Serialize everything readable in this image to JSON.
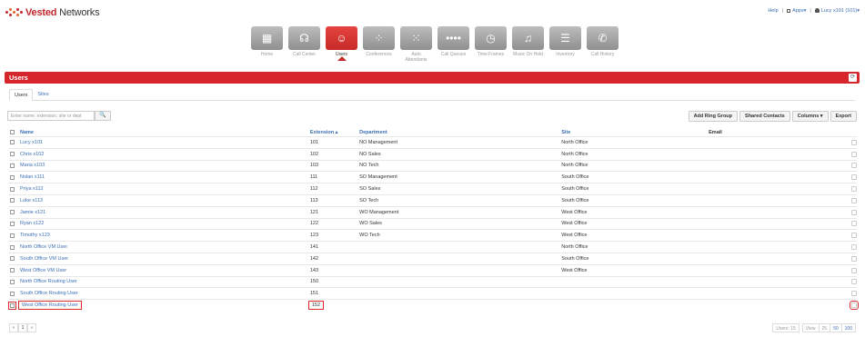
{
  "brand": {
    "part1": "Vested",
    "part2": " Networks"
  },
  "top_links": {
    "help": "Help",
    "apps": "Apps▾",
    "user": "Lucy x101 (101)▾",
    "sep": "|"
  },
  "nav": [
    {
      "label": "Home",
      "icon": "home-icon",
      "glyph": "▦"
    },
    {
      "label": "Call Center",
      "icon": "headset-icon",
      "glyph": "☊"
    },
    {
      "label": "Users",
      "icon": "users-icon",
      "glyph": "☺",
      "active": true
    },
    {
      "label": "Conferences",
      "icon": "conference-icon",
      "glyph": "⁘"
    },
    {
      "label": "Auto Attendants",
      "icon": "keypad-icon",
      "glyph": "⁙"
    },
    {
      "label": "Call Queues",
      "icon": "queue-icon",
      "glyph": "••••"
    },
    {
      "label": "Time Frames",
      "icon": "clock-icon",
      "glyph": "◷"
    },
    {
      "label": "Music On Hold",
      "icon": "music-icon",
      "glyph": "♫"
    },
    {
      "label": "Inventory",
      "icon": "inventory-icon",
      "glyph": "☰"
    },
    {
      "label": "Call History",
      "icon": "call-history-icon",
      "glyph": "✆"
    }
  ],
  "section_title": "Users",
  "tabs": [
    "Users",
    "Sites"
  ],
  "search": {
    "placeholder": "Enter name, extension, site or dept",
    "button": "🔍"
  },
  "actions": [
    "Add Ring Group",
    "Shared Contacts",
    "Columns ▾",
    "Export"
  ],
  "columns": {
    "name": "Name",
    "extension": "Extension ▴",
    "department": "Department",
    "site": "Site",
    "email": "Email"
  },
  "rows": [
    {
      "name": "Lucy x101",
      "ext": "101",
      "dept": "NO Management",
      "site": "North Office"
    },
    {
      "name": "Chris x102",
      "ext": "102",
      "dept": "NO Sales",
      "site": "North Office"
    },
    {
      "name": "Maria x103",
      "ext": "103",
      "dept": "NO Tech",
      "site": "North Office"
    },
    {
      "name": "Nolan x111",
      "ext": "111",
      "dept": "SO Management",
      "site": "South Office"
    },
    {
      "name": "Priya x112",
      "ext": "112",
      "dept": "SO Sales",
      "site": "South Office"
    },
    {
      "name": "Luke x113",
      "ext": "113",
      "dept": "SO Tech",
      "site": "South Office"
    },
    {
      "name": "Jamie x121",
      "ext": "121",
      "dept": "WO Management",
      "site": "West Office"
    },
    {
      "name": "Ryan x122",
      "ext": "122",
      "dept": "WO Sales",
      "site": "West Office"
    },
    {
      "name": "Timothy x123",
      "ext": "123",
      "dept": "WO Tech",
      "site": "West Office"
    },
    {
      "name": "North Office VM User",
      "ext": "141",
      "dept": "",
      "site": "North Office"
    },
    {
      "name": "South Office VM User",
      "ext": "142",
      "dept": "",
      "site": "South Office"
    },
    {
      "name": "West Office VM User",
      "ext": "143",
      "dept": "",
      "site": "West Office"
    },
    {
      "name": "North Office Routing User",
      "ext": "150",
      "dept": "",
      "site": ""
    },
    {
      "name": "South Office Routing User",
      "ext": "151",
      "dept": "",
      "site": ""
    },
    {
      "name": "West Office Routing User",
      "ext": "152",
      "dept": "",
      "site": "",
      "highlight": true
    }
  ],
  "pager": {
    "prev": "«",
    "page": "1",
    "next": "»"
  },
  "footer": {
    "count": "Users: 15",
    "view": "View",
    "sizes": [
      "25",
      "50",
      "100"
    ]
  },
  "colors": {
    "brand_red": "#d7262b",
    "link": "#3b6fb5"
  }
}
